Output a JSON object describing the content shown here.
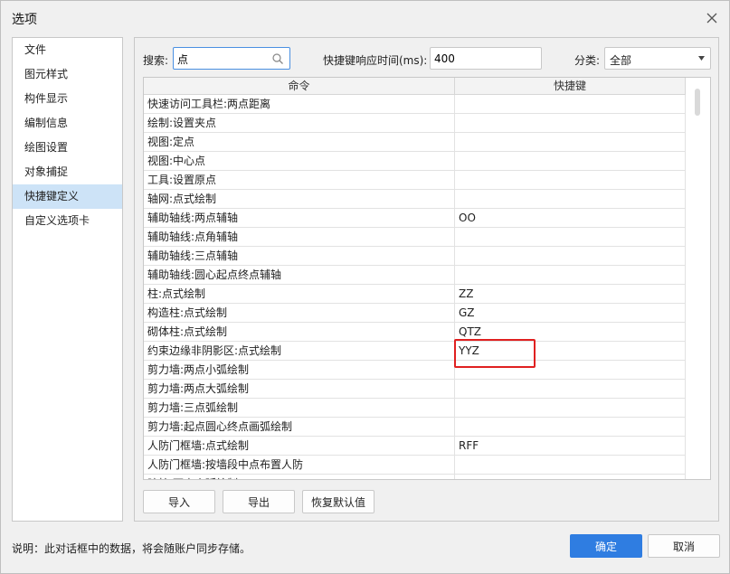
{
  "window": {
    "title": "选项"
  },
  "sidebar": {
    "items": [
      {
        "label": "文件"
      },
      {
        "label": "图元样式"
      },
      {
        "label": "构件显示"
      },
      {
        "label": "编制信息"
      },
      {
        "label": "绘图设置"
      },
      {
        "label": "对象捕捉"
      },
      {
        "label": "快捷键定义",
        "active": true
      },
      {
        "label": "自定义选项卡"
      }
    ]
  },
  "toolbar": {
    "search_label": "搜索:",
    "search_value": "点",
    "response_label": "快捷键响应时间(ms):",
    "response_value": "400",
    "category_label": "分类:",
    "category_value": "全部"
  },
  "table": {
    "columns": [
      "命令",
      "快捷键"
    ],
    "rows": [
      {
        "command": "快速访问工具栏:两点距离",
        "shortcut": ""
      },
      {
        "command": "绘制:设置夹点",
        "shortcut": ""
      },
      {
        "command": "视图:定点",
        "shortcut": ""
      },
      {
        "command": "视图:中心点",
        "shortcut": ""
      },
      {
        "command": "工具:设置原点",
        "shortcut": ""
      },
      {
        "command": "轴网:点式绘制",
        "shortcut": ""
      },
      {
        "command": "辅助轴线:两点辅轴",
        "shortcut": "OO"
      },
      {
        "command": "辅助轴线:点角辅轴",
        "shortcut": ""
      },
      {
        "command": "辅助轴线:三点辅轴",
        "shortcut": ""
      },
      {
        "command": "辅助轴线:圆心起点终点辅轴",
        "shortcut": ""
      },
      {
        "command": "柱:点式绘制",
        "shortcut": "ZZ"
      },
      {
        "command": "构造柱:点式绘制",
        "shortcut": "GZ"
      },
      {
        "command": "砌体柱:点式绘制",
        "shortcut": "QTZ"
      },
      {
        "command": "约束边缘非阴影区:点式绘制",
        "shortcut": "YYZ"
      },
      {
        "command": "剪力墙:两点小弧绘制",
        "shortcut": ""
      },
      {
        "command": "剪力墙:两点大弧绘制",
        "shortcut": ""
      },
      {
        "command": "剪力墙:三点弧绘制",
        "shortcut": ""
      },
      {
        "command": "剪力墙:起点圆心终点画弧绘制",
        "shortcut": ""
      },
      {
        "command": "人防门框墙:点式绘制",
        "shortcut": "RFF"
      },
      {
        "command": "人防门框墙:按墙段中点布置人防",
        "shortcut": ""
      },
      {
        "command": "暗柱:两点小弧绘制",
        "shortcut": ""
      }
    ]
  },
  "buttons": {
    "import": "导入",
    "export": "导出",
    "restore": "恢复默认值",
    "ok": "确定",
    "cancel": "取消"
  },
  "footer": {
    "note": "说明：此对话框中的数据，将会随账户同步存储。"
  },
  "colors": {
    "accent": "#2f7de1",
    "selection": "#cde3f7",
    "highlight_box": "#e02020"
  }
}
